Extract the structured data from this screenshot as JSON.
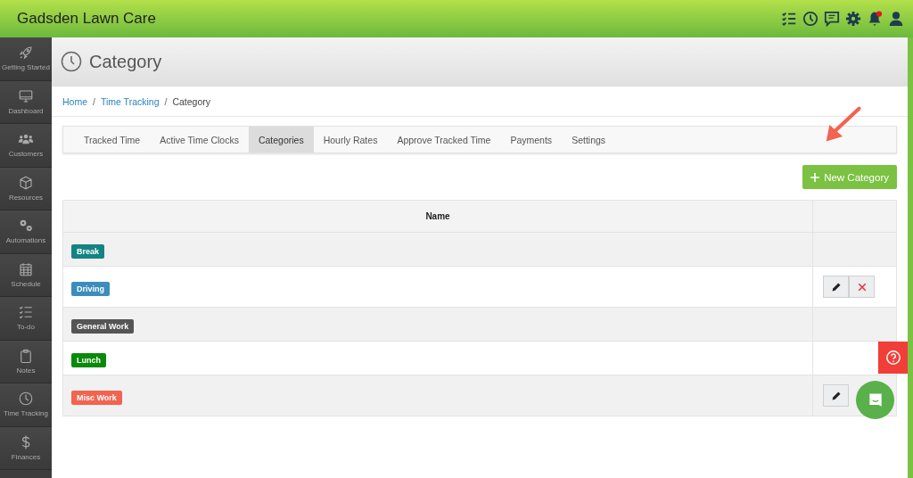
{
  "app": {
    "title": "Gadsden Lawn Care",
    "notification_badge": true
  },
  "sidebar": {
    "items": [
      {
        "kind": "rocket",
        "label": "Getting Started",
        "selected": false
      },
      {
        "kind": "monitor",
        "label": "Dashboard",
        "selected": false
      },
      {
        "kind": "people",
        "label": "Customers",
        "selected": false
      },
      {
        "kind": "cube",
        "label": "Resources",
        "selected": false
      },
      {
        "kind": "gears",
        "label": "Automations",
        "selected": false
      },
      {
        "kind": "calendar",
        "label": "Schedule",
        "selected": false
      },
      {
        "kind": "checklist",
        "label": "To-do",
        "selected": false
      },
      {
        "kind": "clipboard",
        "label": "Notes",
        "selected": false
      },
      {
        "kind": "clock",
        "label": "Time Tracking",
        "selected": false
      },
      {
        "kind": "dollar",
        "label": "Finances",
        "selected": false
      }
    ]
  },
  "page": {
    "title": "Category"
  },
  "breadcrumb_separator": "/",
  "breadcrumb": [
    {
      "label": "Home",
      "link": true
    },
    {
      "label": "Time Tracking",
      "link": true
    },
    {
      "label": "Category",
      "link": false
    }
  ],
  "tabs": [
    {
      "label": "Tracked Time",
      "selected": false
    },
    {
      "label": "Active Time Clocks",
      "selected": false
    },
    {
      "label": "Categories",
      "selected": true
    },
    {
      "label": "Hourly Rates",
      "selected": false
    },
    {
      "label": "Approve Tracked Time",
      "selected": false
    },
    {
      "label": "Payments",
      "selected": false
    },
    {
      "label": "Settings",
      "selected": false
    }
  ],
  "new_button": {
    "label": "New Category"
  },
  "table": {
    "columns": [
      "Name"
    ],
    "rows": [
      {
        "name": "Break",
        "color": "#138383",
        "edit_button": false,
        "delete_button": false
      },
      {
        "name": "Driving",
        "color": "#3b8dbd",
        "edit_button": true,
        "delete_button": true
      },
      {
        "name": "General Work",
        "color": "#555555",
        "edit_button": false,
        "delete_button": false
      },
      {
        "name": "Lunch",
        "color": "#0a8a0a",
        "edit_button": false,
        "delete_button": false
      },
      {
        "name": "Misc Work",
        "color": "#f26350",
        "edit_button": true,
        "delete_button": false
      }
    ]
  }
}
